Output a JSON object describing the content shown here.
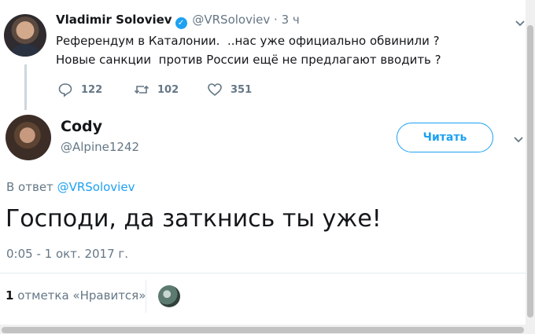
{
  "parent_tweet": {
    "name": "Vladimir Soloviev",
    "handle": "@VRSoloviev",
    "separator": "·",
    "time": "3 ч",
    "text": "Референдум в Каталонии.  ..нас уже официально обвинили ?Новые санкции  против России ещё не предлагают вводить ?",
    "replies": "122",
    "retweets": "102",
    "likes": "351"
  },
  "main_tweet": {
    "name": "Cody",
    "handle": "@Alpine1242",
    "follow_label": "Читать",
    "reply_prefix": "В ответ",
    "reply_to": "@VRSoloviev",
    "text": "Господи, да заткнись ты уже!",
    "timestamp": "0:05 - 1 окт. 2017 г.",
    "likes_count": "1",
    "likes_label": "отметка «Нравится»"
  },
  "colors": {
    "accent": "#1da1f2",
    "muted": "#657786"
  },
  "icons": [
    "verified-icon",
    "chevron-down-icon",
    "reply-icon",
    "retweet-icon",
    "like-icon"
  ]
}
